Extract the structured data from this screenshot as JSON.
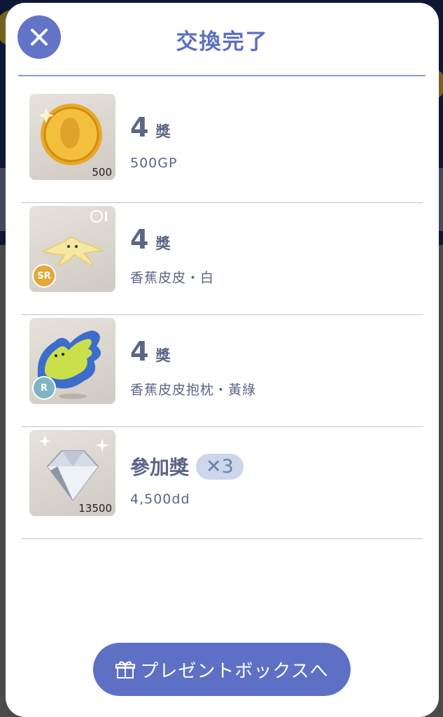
{
  "modal": {
    "title": "交換完了",
    "close_icon": "close-icon"
  },
  "rewards": [
    {
      "thumbnail": "gold-coin-image",
      "quantity": "500",
      "rank_number": "4",
      "rank_unit": "獎",
      "description": "500GP",
      "rarity": ""
    },
    {
      "thumbnail": "banana-peel-image",
      "quantity": "",
      "rank_number": "4",
      "rank_unit": "獎",
      "description": "香蕉皮皮・白",
      "rarity": "SR"
    },
    {
      "thumbnail": "banana-peel-pillow-image",
      "quantity": "",
      "rank_number": "4",
      "rank_unit": "獎",
      "description": "香蕉皮皮抱枕・黃綠",
      "rarity": "R"
    },
    {
      "thumbnail": "diamond-image",
      "quantity": "13500",
      "rank_label": "參加獎",
      "multiplier": "✕3",
      "description": "4,500dd",
      "rarity": ""
    }
  ],
  "footer": {
    "present_box_button": "プレゼントボックスへ",
    "gift_icon": "gift-icon"
  },
  "colors": {
    "accent": "#5e70c6",
    "title": "#5d6fbf",
    "text": "#5a6587",
    "rarity_sr": "#e0a93a",
    "rarity_r": "#7fb4c4"
  }
}
